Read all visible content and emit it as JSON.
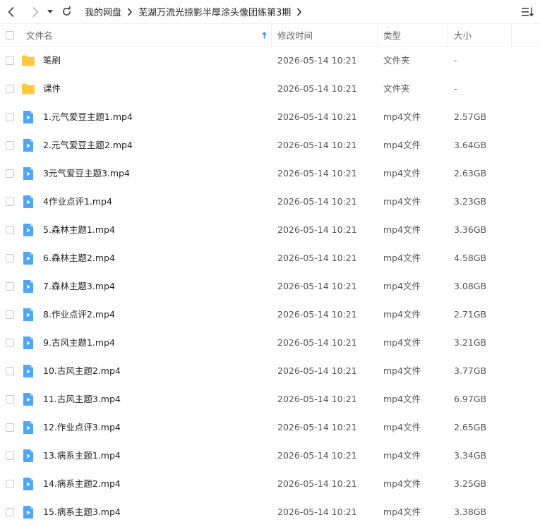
{
  "breadcrumb": [
    "我的网盘",
    "芜湖万流光掠影半厚涂头像团练第3期"
  ],
  "columns": {
    "name": "文件名",
    "modified": "修改时间",
    "type": "类型",
    "size": "大小"
  },
  "colors": {
    "folder": "#FFC83D",
    "video": "#4EA6F5",
    "sort_arrow": "#3B8EEA"
  },
  "files": [
    {
      "name": "笔刷",
      "modified": "2026-05-14 10:21",
      "type": "文件夹",
      "size": "-",
      "icon": "folder-icon"
    },
    {
      "name": "课件",
      "modified": "2026-05-14 10:21",
      "type": "文件夹",
      "size": "-",
      "icon": "folder-icon"
    },
    {
      "name": "1.元气爱豆主题1.mp4",
      "modified": "2026-05-14 10:21",
      "type": "mp4文件",
      "size": "2.57GB",
      "icon": "video-file-icon"
    },
    {
      "name": "2.元气爱豆主题2.mp4",
      "modified": "2026-05-14 10:21",
      "type": "mp4文件",
      "size": "3.64GB",
      "icon": "video-file-icon"
    },
    {
      "name": "3元气爱豆主题3.mp4",
      "modified": "2026-05-14 10:21",
      "type": "mp4文件",
      "size": "2.63GB",
      "icon": "video-file-icon"
    },
    {
      "name": "4作业点评1.mp4",
      "modified": "2026-05-14 10:21",
      "type": "mp4文件",
      "size": "3.23GB",
      "icon": "video-file-icon"
    },
    {
      "name": "5.森林主题1.mp4",
      "modified": "2026-05-14 10:21",
      "type": "mp4文件",
      "size": "3.36GB",
      "icon": "video-file-icon"
    },
    {
      "name": "6.森林主题2.mp4",
      "modified": "2026-05-14 10:21",
      "type": "mp4文件",
      "size": "4.58GB",
      "icon": "video-file-icon"
    },
    {
      "name": "7.森林主题3.mp4",
      "modified": "2026-05-14 10:21",
      "type": "mp4文件",
      "size": "3.08GB",
      "icon": "video-file-icon"
    },
    {
      "name": "8.作业点评2.mp4",
      "modified": "2026-05-14 10:21",
      "type": "mp4文件",
      "size": "2.71GB",
      "icon": "video-file-icon"
    },
    {
      "name": "9.古风主题1.mp4",
      "modified": "2026-05-14 10:21",
      "type": "mp4文件",
      "size": "3.21GB",
      "icon": "video-file-icon"
    },
    {
      "name": "10.古风主题2.mp4",
      "modified": "2026-05-14 10:21",
      "type": "mp4文件",
      "size": "3.77GB",
      "icon": "video-file-icon"
    },
    {
      "name": "11.古风主题3.mp4",
      "modified": "2026-05-14 10:21",
      "type": "mp4文件",
      "size": "6.97GB",
      "icon": "video-file-icon"
    },
    {
      "name": "12.作业点评3.mp4",
      "modified": "2026-05-14 10:21",
      "type": "mp4文件",
      "size": "2.65GB",
      "icon": "video-file-icon"
    },
    {
      "name": "13.病系主题1.mp4",
      "modified": "2026-05-14 10:21",
      "type": "mp4文件",
      "size": "3.34GB",
      "icon": "video-file-icon"
    },
    {
      "name": "14.病系主题2.mp4",
      "modified": "2026-05-14 10:21",
      "type": "mp4文件",
      "size": "3.25GB",
      "icon": "video-file-icon"
    },
    {
      "name": "15.病系主题3.mp4",
      "modified": "2026-05-14 10:21",
      "type": "mp4文件",
      "size": "3.38GB",
      "icon": "video-file-icon"
    }
  ]
}
